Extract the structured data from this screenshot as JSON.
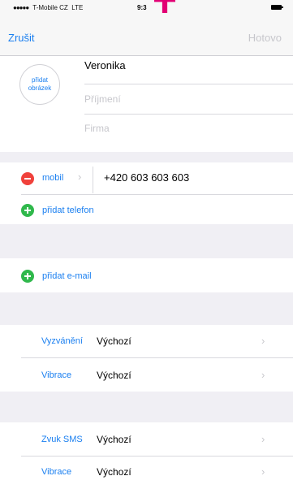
{
  "status_bar": {
    "carrier": "T-Mobile CZ",
    "network": "LTE",
    "time": "9:3"
  },
  "navbar": {
    "cancel_label": "Zrušit",
    "done_label": "Hotovo"
  },
  "contact": {
    "avatar_label_line1": "přidat",
    "avatar_label_line2": "obrázek",
    "first_name": "Veronika",
    "last_name_placeholder": "Příjmení",
    "company_placeholder": "Firma"
  },
  "phone": {
    "label": "mobil",
    "number": "+420 603 603 603",
    "add_phone_label": "přidat telefon"
  },
  "email": {
    "add_email_label": "přidat e-mail"
  },
  "ringtone_group": {
    "rows": [
      {
        "label": "Vyzvánění",
        "value": "Výchozí"
      },
      {
        "label": "Vibrace",
        "value": "Výchozí"
      }
    ]
  },
  "sms_group": {
    "rows": [
      {
        "label": "Zvuk SMS",
        "value": "Výchozí"
      },
      {
        "label": "Vibrace",
        "value": "Výchozí"
      }
    ]
  },
  "colors": {
    "accent_blue": "#1a7ff0",
    "delete_red": "#f0413b",
    "add_green": "#2fb84b",
    "carrier_magenta": "#e20074"
  },
  "icons": {
    "chevron": "›"
  }
}
